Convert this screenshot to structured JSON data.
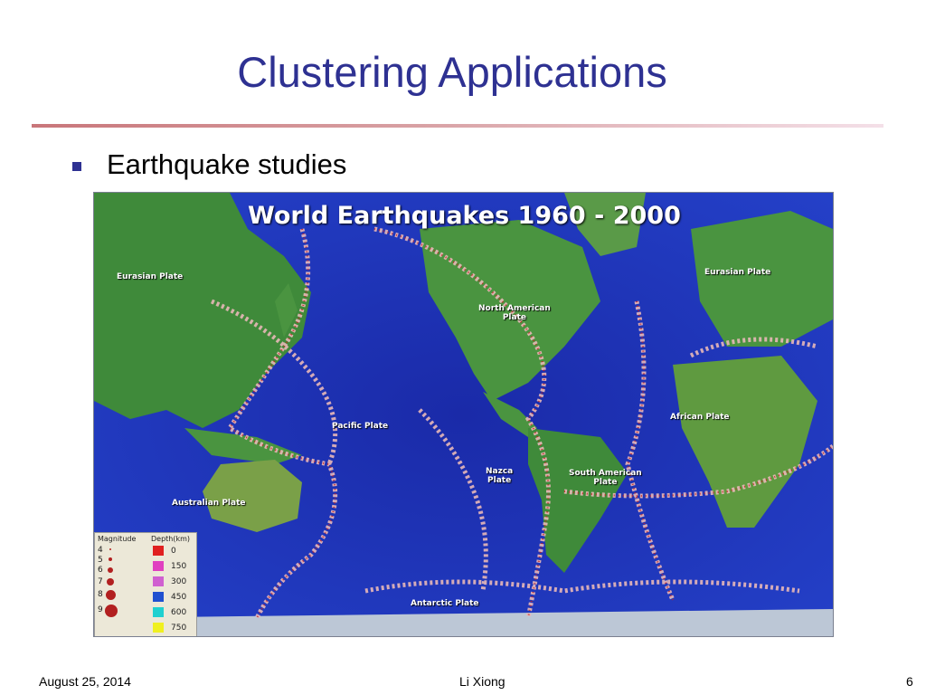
{
  "slide": {
    "title": "Clustering Applications",
    "bullet": "Earthquake studies",
    "footer": {
      "date": "August 25, 2014",
      "author": "Li Xiong",
      "page": "6"
    },
    "colors": {
      "title": "#2e3192",
      "bullet": "#2e3192",
      "rule": "#c9767a"
    }
  },
  "map": {
    "title": "World Earthquakes 1960 - 2000",
    "plates": {
      "eurasian_left": "Eurasian Plate",
      "eurasian_right": "Eurasian Plate",
      "north_american": "North American\nPlate",
      "pacific": "Pacific Plate",
      "african": "African Plate",
      "nazca": "Nazca\nPlate",
      "south_american": "South American\nPlate",
      "australian": "Australian Plate",
      "antarctic": "Antarctic Plate"
    },
    "legend": {
      "magnitude_header": "Magnitude",
      "depth_header": "Depth(km)",
      "magnitudes": [
        "4",
        "5",
        "6",
        "7",
        "8",
        "9"
      ],
      "depths": [
        "0",
        "150",
        "300",
        "450",
        "600",
        "750"
      ],
      "depth_colors": [
        "#e02020",
        "#e040c0",
        "#d060d0",
        "#2050d0",
        "#20d0d0",
        "#f0f020"
      ]
    }
  }
}
